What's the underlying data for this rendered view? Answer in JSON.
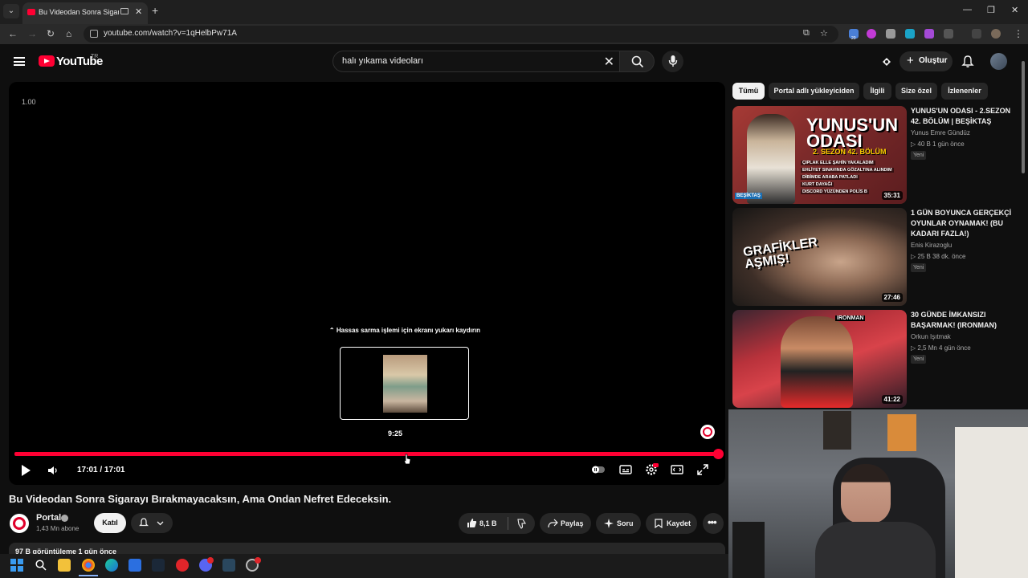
{
  "browser": {
    "tab_title": "Bu Videodan Sonra Sigaray",
    "url": "youtube.com/watch?v=1qHelbPw71A",
    "new_tab": "+",
    "tab_close": "✕",
    "win_min": "—",
    "win_max": "❐",
    "win_close": "✕",
    "ext_badge": "20"
  },
  "header": {
    "logo": "YouTube",
    "region": "TR",
    "search_value": "halı yıkama videoları",
    "clear": "✕",
    "create_label": "Oluştur",
    "create_plus": "+"
  },
  "player": {
    "speed": "1.00",
    "seek_hint": "⌃ Hassas sarma işlemi için ekranı yukarı kaydırın",
    "preview_time": "9:25",
    "current_time": "17:01 / 17:01",
    "progress_fraction": 1.0,
    "hover_fraction": 0.55
  },
  "video": {
    "title": "Bu Videodan Sonra Sigarayı Bırakmayacaksın, Ama Ondan Nefret Edeceksin.",
    "channel": "Portal",
    "subscribers": "1,43 Mn abone",
    "join_label": "Katıl",
    "likes": "8,1 B",
    "share_label": "Paylaş",
    "ask_label": "Soru",
    "save_label": "Kaydet",
    "views_line": "97 B görüntüleme  1 gün önce"
  },
  "chips": [
    {
      "label": "Tümü",
      "active": true
    },
    {
      "label": "Portal adlı yükleyiciden",
      "active": false
    },
    {
      "label": "İlgili",
      "active": false
    },
    {
      "label": "Size özel",
      "active": false
    },
    {
      "label": "İzlenenler",
      "active": false
    }
  ],
  "recommendations": [
    {
      "title": "YUNUS'UN ODASI - 2.SEZON 42. BÖLÜM | BEŞİKTAŞ",
      "channel": "Yunus Emre Gündüz",
      "meta": "▷ 40 B   1 gün önce",
      "badge": "Yeni",
      "duration": "35:31",
      "thumb_title": "YUNUS'UN ODASI",
      "thumb_sub": "2. SEZON 42. BÖLÜM",
      "thumb_lines": [
        "ÇIPLAK ELLE ŞAHİN YAKALADIM",
        "EHLİYET SINAVINDA GÖZALTINA ALINDIM",
        "DİBİMDE ARABA PATLADI",
        "KURT DAYAĞI",
        "DISCORD YÜZÜNDEN POLİS B"
      ],
      "thumb_tag": "BEŞİKTAŞ"
    },
    {
      "title": "1 GÜN BOYUNCA GERÇEKÇİ OYUNLAR OYNAMAK! (BU KADARI FAZLA!)",
      "channel": "Enis Kirazoglu",
      "meta": "▷ 25 B   38 dk. önce",
      "badge": "Yeni",
      "duration": "27:46",
      "thumb_title": "GRAFİKLER AŞMIŞ!"
    },
    {
      "title": "30 GÜNDE İMKANSIZI BAŞARMAK! (IRONMAN)",
      "channel": "Orkun Işıtmak",
      "meta": "▷ 2,5 Mn   4 gün önce",
      "badge": "Yeni",
      "duration": "41:22",
      "thumb_title": "IRONMAN"
    }
  ],
  "colors": {
    "accent": "#ff0033",
    "bg": "#0f0f0f",
    "chip": "#272727"
  }
}
